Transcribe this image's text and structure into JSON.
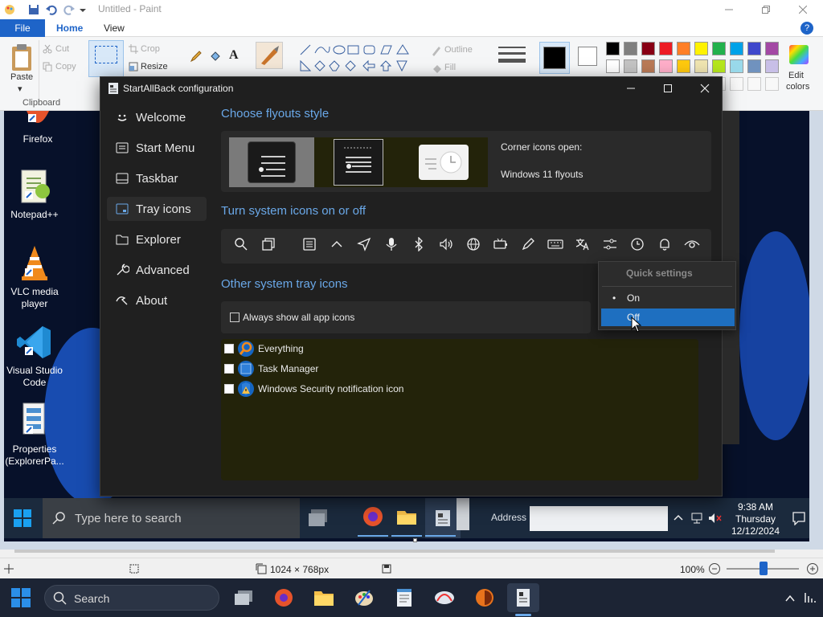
{
  "paint": {
    "title": "Untitled - Paint",
    "tabs": {
      "file": "File",
      "home": "Home",
      "view": "View"
    },
    "help": "?",
    "ribbon": {
      "paste": "Paste",
      "cut": "Cut",
      "copy": "Copy",
      "crop": "Crop",
      "resize": "Resize",
      "outline": "Outline",
      "fill": "Fill",
      "clipboard": "Clipboard",
      "edit_colors_1": "Edit",
      "edit_colors_2": "colors",
      "color_row1": [
        "#000000",
        "#7f7f7f",
        "#880015",
        "#ed1c24",
        "#ff7f27",
        "#fff200",
        "#22b14c",
        "#00a2e8",
        "#3f48cc",
        "#a349a4"
      ],
      "color_row2": [
        "#ffffff",
        "#c3c3c3",
        "#b97a57",
        "#ffaec9",
        "#ffc90e",
        "#efe4b0",
        "#b5e61d",
        "#99d9ea",
        "#7092be",
        "#c8bfe7"
      ]
    },
    "status": {
      "size": "1024 × 768px",
      "zoom": "100%"
    }
  },
  "desktop": {
    "icons": [
      {
        "label": "Firefox"
      },
      {
        "label": "Notepad++"
      },
      {
        "label": "VLC media player"
      },
      {
        "label": "Visual Studio Code"
      },
      {
        "label": "Properties (ExplorerPa..."
      }
    ]
  },
  "inner_taskbar": {
    "search_placeholder": "Type here to search",
    "address_label": "Address",
    "time": "9:38 AM",
    "day": "Thursday",
    "date": "12/12/2024"
  },
  "sab": {
    "title": "StartAllBack configuration",
    "nav": [
      {
        "label": "Welcome",
        "icon": "smile-icon"
      },
      {
        "label": "Start Menu",
        "icon": "start-menu-icon"
      },
      {
        "label": "Taskbar",
        "icon": "taskbar-icon"
      },
      {
        "label": "Tray icons",
        "icon": "tray-icon"
      },
      {
        "label": "Explorer",
        "icon": "folder-icon"
      },
      {
        "label": "Advanced",
        "icon": "wrench-icon"
      },
      {
        "label": "About",
        "icon": "about-icon"
      }
    ],
    "active_nav": "Tray icons",
    "flyouts": {
      "title": "Choose flyouts style",
      "corner_label": "Corner icons open:",
      "value": "Windows 11 flyouts"
    },
    "system_icons": {
      "title": "Turn system icons on or off",
      "icons": [
        "search-icon",
        "task-view-icon",
        "widgets-icon",
        "chevron-up-icon",
        "location-icon",
        "microphone-icon",
        "bluetooth-icon",
        "volume-icon",
        "network-icon",
        "battery-icon",
        "pen-icon",
        "keyboard-icon",
        "language-icon",
        "quick-settings-icon",
        "clock-icon",
        "notifications-icon",
        "eye-icon"
      ]
    },
    "other_tray": {
      "title": "Other system tray icons",
      "always_show": "Always show all app icons",
      "apps": [
        {
          "label": "Everything",
          "icon": "everything-icon"
        },
        {
          "label": "Task Manager",
          "icon": "task-manager-icon"
        },
        {
          "label": "Windows Security notification icon",
          "icon": "shield-icon"
        }
      ]
    },
    "quick_settings_menu": {
      "header": "Quick settings",
      "options": [
        "On",
        "Off"
      ],
      "selected": "Off",
      "current": "On"
    }
  },
  "win_taskbar": {
    "search_placeholder": "Search"
  }
}
